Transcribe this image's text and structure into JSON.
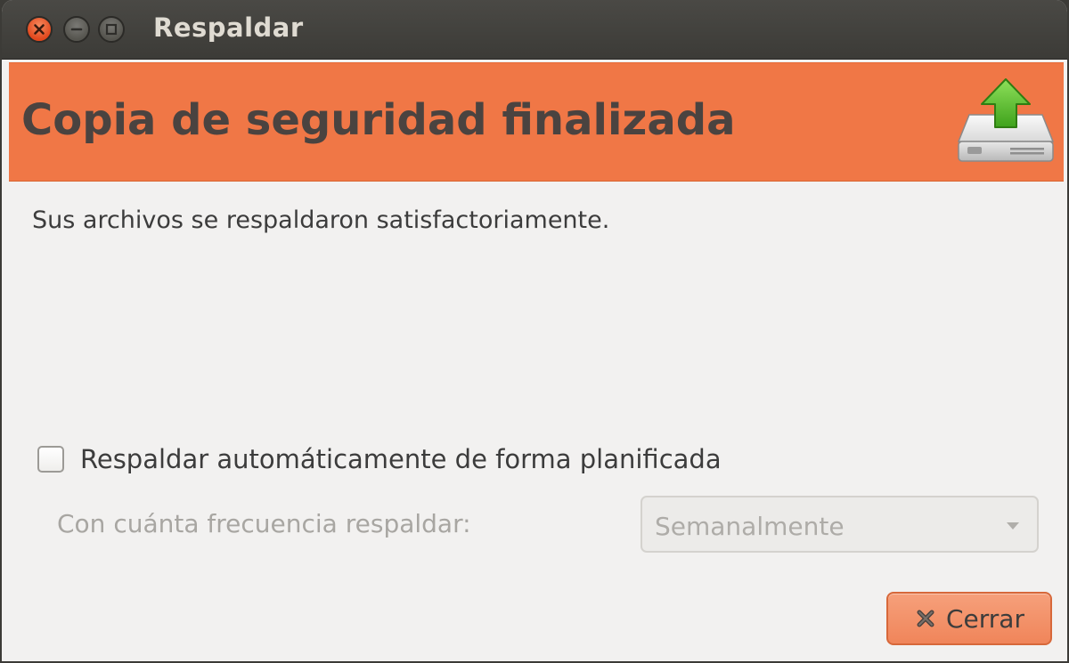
{
  "window": {
    "title": "Respaldar"
  },
  "banner": {
    "heading": "Copia de seguridad finalizada",
    "icon": "backup-drive-upload-icon",
    "color": "#f07746"
  },
  "body": {
    "message": "Sus archivos se respaldaron satisfactoriamente."
  },
  "schedule": {
    "checkbox_label": "Respaldar automáticamente de forma planificada",
    "checked": false,
    "frequency_label": "Con cuánta frecuencia respaldar:",
    "frequency_value": "Semanalmente",
    "enabled": false
  },
  "actions": {
    "close_label": "Cerrar",
    "close_icon": "close-x-icon"
  }
}
